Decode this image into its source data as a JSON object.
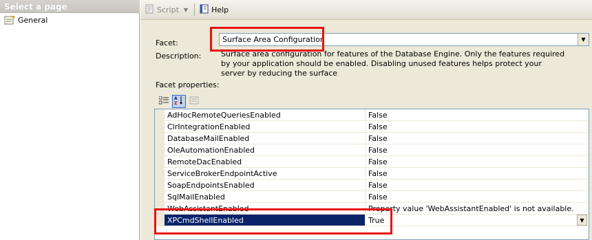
{
  "left": {
    "header": "Select a page",
    "pages": [
      {
        "label": "General",
        "icon": "page-icon"
      }
    ]
  },
  "toolbar": {
    "script_label": "Script",
    "help_label": "Help",
    "script_icon": "script-icon",
    "help_icon": "help-icon"
  },
  "facet": {
    "label": "Facet:",
    "value": "Surface Area Configuration"
  },
  "description": {
    "label": "Description:",
    "text": "Surface area configuration for features of the Database Engine. Only the features required by your application should be enabled. Disabling unused features helps protect your server by reducing the surface"
  },
  "facet_properties_label": "Facet properties:",
  "properties": [
    {
      "name": "AdHocRemoteQueriesEnabled",
      "value": "False"
    },
    {
      "name": "ClrIntegrationEnabled",
      "value": "False"
    },
    {
      "name": "DatabaseMailEnabled",
      "value": "False"
    },
    {
      "name": "OleAutomationEnabled",
      "value": "False"
    },
    {
      "name": "RemoteDacEnabled",
      "value": "False"
    },
    {
      "name": "ServiceBrokerEndpointActive",
      "value": "False"
    },
    {
      "name": "SoapEndpointsEnabled",
      "value": "False"
    },
    {
      "name": "SqlMailEnabled",
      "value": "False"
    },
    {
      "name": "WebAssistantEnabled",
      "value": "Property value 'WebAssistantEnabled' is not available."
    },
    {
      "name": "XPCmdShellEnabled",
      "value": "True"
    }
  ],
  "colors": {
    "highlight": "#e81010",
    "selection": "#0a246a"
  }
}
